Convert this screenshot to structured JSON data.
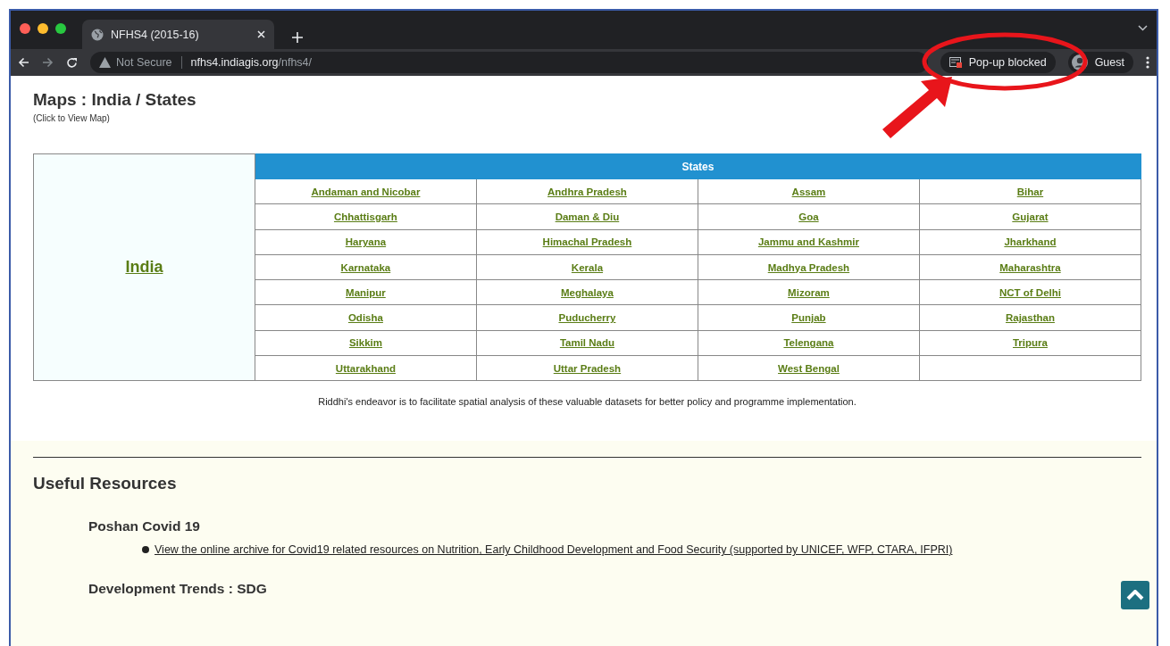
{
  "browser": {
    "tabs": [
      {
        "title": "NFHS4 (2015-16)",
        "selected": true
      }
    ],
    "address": {
      "security": "Not Secure",
      "host": "nfhs4.indiagis.org",
      "path": "/nfhs4/"
    },
    "popup_notice": "Pop-up blocked",
    "profile": "Guest"
  },
  "page": {
    "title": "Maps : India / States",
    "subtitle": "(Click to View Map)",
    "country_link": "India",
    "states_header": "States",
    "states": [
      "Andaman and Nicobar",
      "Andhra Pradesh",
      "Assam",
      "Bihar",
      "Chhattisgarh",
      "Daman & Diu",
      "Goa",
      "Gujarat",
      "Haryana",
      "Himachal Pradesh",
      "Jammu and Kashmir",
      "Jharkhand",
      "Karnataka",
      "Kerala",
      "Madhya Pradesh",
      "Maharashtra",
      "Manipur",
      "Meghalaya",
      "Mizoram",
      "NCT of Delhi",
      "Odisha",
      "Puducherry",
      "Punjab",
      "Rajasthan",
      "Sikkim",
      "Tamil Nadu",
      "Telengana",
      "Tripura",
      "Uttarakhand",
      "Uttar Pradesh",
      "West Bengal"
    ],
    "caption": "Riddhi's endeavor is to facilitate spatial analysis of these valuable datasets for better policy and programme implementation.",
    "resources": {
      "title": "Useful Resources",
      "groups": [
        {
          "title": "Poshan Covid 19",
          "links": [
            "View the online archive for Covid19 related resources on Nutrition, Early Childhood Development and Food Security (supported by UNICEF, WFP, CTARA, IFPRI)"
          ]
        },
        {
          "title": "Development Trends : SDG"
        }
      ]
    }
  }
}
